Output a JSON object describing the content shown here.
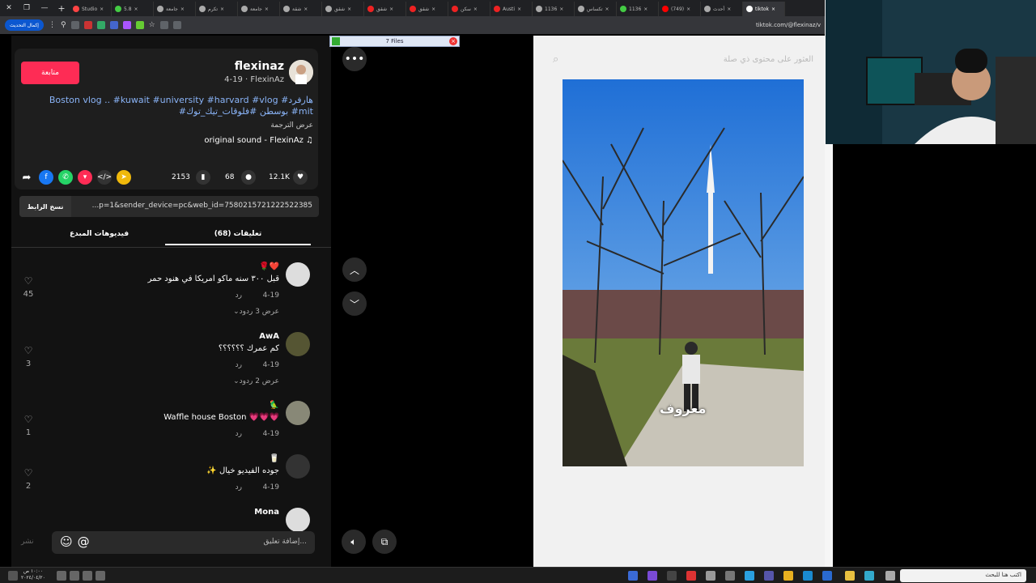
{
  "browser": {
    "tabs": [
      {
        "label": "Studio",
        "color": "#f44"
      },
      {
        "label": "5.8",
        "color": "#4c4"
      },
      {
        "label": "جامعة",
        "color": "#aaa"
      },
      {
        "label": "تكرم",
        "color": "#aaa"
      },
      {
        "label": "جامعة",
        "color": "#aaa"
      },
      {
        "label": "شقة",
        "color": "#aaa"
      },
      {
        "label": "شقق",
        "color": "#aaa"
      },
      {
        "label": "شقق",
        "color": "#e22"
      },
      {
        "label": "شقق",
        "color": "#e22"
      },
      {
        "label": "سكن",
        "color": "#e22"
      },
      {
        "label": "Austi",
        "color": "#e22"
      },
      {
        "label": "1136",
        "color": "#aaa"
      },
      {
        "label": "تكساس",
        "color": "#aaa"
      },
      {
        "label": "1136",
        "color": "#4c4"
      },
      {
        "label": "(749)",
        "color": "#f00"
      },
      {
        "label": "أحدث",
        "color": "#aaa"
      },
      {
        "label": "tiktok",
        "color": "#fff"
      }
    ],
    "update_label": "إكمال التحديث",
    "url": "tiktok.com/@flexinaz/v"
  },
  "post": {
    "username": "flexinaz",
    "subline": "4-19 · FlexinAz",
    "follow_label": "متابعة",
    "desc_line1": "Boston vlog .. #kuwait #university #harvard #vlog #هارفرد",
    "desc_line2": "#بوسطن #فلوقات_تيك_توك #mit",
    "translate_label": "عرض الترجمة",
    "sound": "original sound - FlexinAz",
    "likes": "12.1K",
    "comments_count": "68",
    "saves": "2153",
    "link": "...p=1&sender_device=pc&web_id=7580215721222522385",
    "copy_label": "نسخ الرابط"
  },
  "tabs": {
    "comments": "(68) تعليقات",
    "creator_videos": "فيديوهات المبدع"
  },
  "comments": [
    {
      "name": "🌹❤️",
      "text": "قبل ٣٠٠ سنه ماكو امريكا في هنود حمر",
      "date": "4-19",
      "reply": "رد",
      "more": "عرض 3 ردود",
      "likes": "45",
      "avatar": "#ddd"
    },
    {
      "name": "AwA",
      "text": "كم عمرك ؟؟؟؟؟؟",
      "date": "4-19",
      "reply": "رد",
      "more": "عرض 2 ردود",
      "likes": "3",
      "avatar": "#553"
    },
    {
      "name": "🦜",
      "text": "Waffle house Boston 💗💗💗",
      "date": "4-19",
      "reply": "رد",
      "more": "",
      "likes": "1",
      "avatar": "#887"
    },
    {
      "name": "🥛",
      "text": "✨ جوده الفيديو خيال",
      "date": "4-19",
      "reply": "رد",
      "more": "",
      "likes": "2",
      "avatar": "#333"
    },
    {
      "name": "Mona",
      "text": "",
      "date": "",
      "reply": "",
      "more": "",
      "likes": "",
      "avatar": "#ddd"
    }
  ],
  "composer": {
    "placeholder": "إضافة تعليق...",
    "post_label": "نشر",
    "emoji_icon": "☺",
    "mention_icon": "@"
  },
  "filebar": {
    "label": "7 Files"
  },
  "preview": {
    "search_placeholder": "العثور على محتوى ذي صلة",
    "overlay_text": "معروف"
  },
  "taskbar": {
    "time": "١٠:٠٠ ص",
    "date": "٢٠٢٤/٠٤/٢٠",
    "search_placeholder": "اكتب هنا للبحث"
  }
}
